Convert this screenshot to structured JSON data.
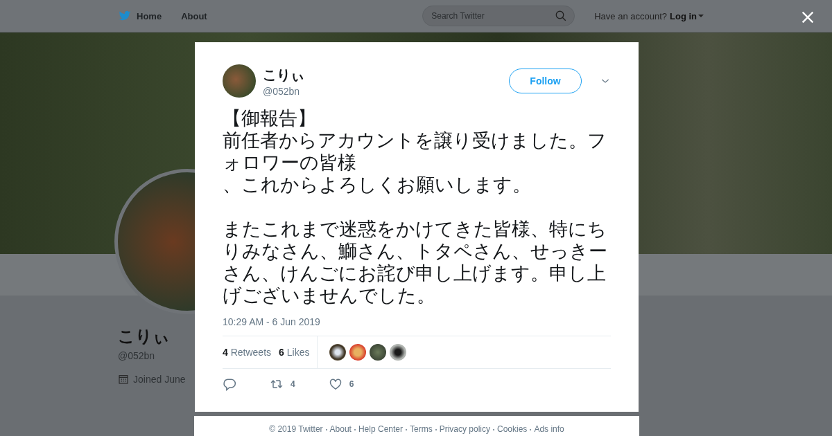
{
  "nav": {
    "items": [
      {
        "kind": "home",
        "label": "Home"
      },
      {
        "kind": "plain",
        "label": "About"
      }
    ],
    "search": {
      "placeholder": "Search Twitter"
    },
    "account_prompt": "Have an account?",
    "login": "Log in"
  },
  "profile": {
    "name": "こりぃ",
    "handle": "@052bn",
    "joined": "Joined June"
  },
  "tweet": {
    "name": "こりぃ",
    "handle": "@052bn",
    "follow": "Follow",
    "paragraphs": [
      {
        "lines": [
          "【御報告】",
          "前任者からアカウントを譲り受けました。フォロワーの皆様",
          "、これからよろしくお願いします。"
        ]
      },
      {
        "lines": [
          "またこれまで迷惑をかけてきた皆様、特にちりみなさん、鰤さん、トタペさん、せっきーさん、けんごにお詫び申し上げます。申し上げございませんでした。"
        ]
      }
    ],
    "time": "10:29 AM - 6 Jun 2019",
    "stats": [
      {
        "count": "4",
        "label": "Retweets"
      },
      {
        "count": "6",
        "label": "Likes"
      }
    ],
    "actions": [
      {
        "kind": "reply"
      },
      {
        "kind": "retweet",
        "count": "4"
      },
      {
        "kind": "like",
        "count": "6"
      }
    ]
  },
  "footer": [
    "© 2019 Twitter",
    "About",
    "Help Center",
    "Terms",
    "Privacy policy",
    "Cookies",
    "Ads info"
  ]
}
